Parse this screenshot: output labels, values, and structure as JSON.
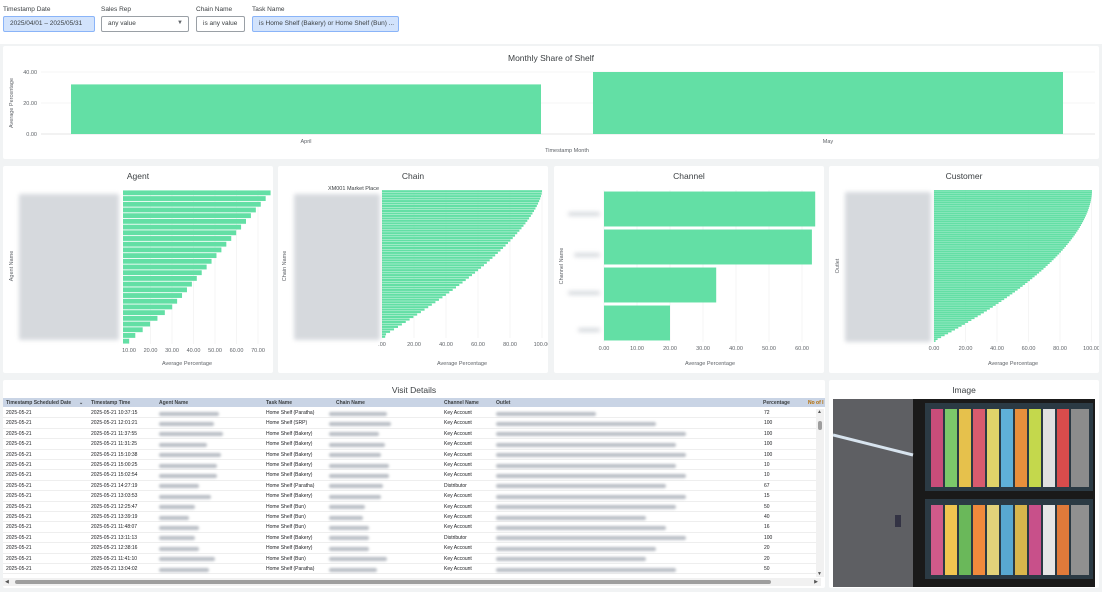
{
  "filters": [
    {
      "label": "Timestamp Date",
      "value": "2025/04/01 – 2025/05/31",
      "active": true
    },
    {
      "label": "Sales Rep",
      "value": "any value",
      "active": false
    },
    {
      "label": "Chain Name",
      "value": "is any value",
      "active": false
    },
    {
      "label": "Task Name",
      "value": "is Home Shelf (Bakery) or Home Shelf (Bun) ...",
      "active": true
    }
  ],
  "monthly": {
    "title": "Monthly Share of Shelf",
    "ylabel": "Average Percentage",
    "xlabel": "Timestamp Month",
    "yticks": [
      "40.00",
      "20.00",
      "0.00"
    ],
    "bars": [
      {
        "label": "April",
        "value": 32
      },
      {
        "label": "May",
        "value": 40
      }
    ]
  },
  "agent": {
    "title": "Agent",
    "ylabel": "Agent Name",
    "xlabel": "Average Percentage",
    "xticks": [
      "10.00",
      "20.00",
      "30.00",
      "40.00",
      "50.00",
      "60.00",
      "70.00"
    ]
  },
  "chain": {
    "title": "Chain",
    "ylabel": "Chain Name",
    "xlabel": "Average Percentage",
    "first_label": "XM001 Market Place",
    "xticks": [
      ".00",
      "20.00",
      "40.00",
      "60.00",
      "80.00",
      "100.00"
    ]
  },
  "channel": {
    "title": "Channel",
    "ylabel": "Channel Name",
    "xlabel": "Average Percentage",
    "xticks": [
      "0.00",
      "10.00",
      "20.00",
      "30.00",
      "40.00",
      "50.00",
      "60.00"
    ]
  },
  "customer": {
    "title": "Customer",
    "ylabel": "Outlet",
    "xlabel": "Average Percentage",
    "xticks": [
      "0.00",
      "20.00",
      "40.00",
      "60.00",
      "80.00",
      "100.00"
    ]
  },
  "visit": {
    "title": "Visit Details",
    "columns": [
      "Timestamp Scheduled Date",
      "Timestamp Time",
      "Agent Name",
      "Task Name",
      "Chain Name",
      "Channel Name",
      "Outlet",
      "Percentage",
      "No of I"
    ],
    "rows": [
      [
        "2025-05-21",
        "2025-05-21 10:37:15",
        "Home Shelf (Paratha)",
        "Key Account",
        "72"
      ],
      [
        "2025-05-21",
        "2025-05-21 12:01:21",
        "Home Shelf (SRP)",
        "Key Account",
        "100"
      ],
      [
        "2025-05-21",
        "2025-05-21 11:37:55",
        "Home Shelf (Bakery)",
        "Key Account",
        "100"
      ],
      [
        "2025-05-21",
        "2025-05-21 11:31:25",
        "Home Shelf (Bakery)",
        "Key Account",
        "100"
      ],
      [
        "2025-05-21",
        "2025-05-21 15:10:38",
        "Home Shelf (Bakery)",
        "Key Account",
        "100"
      ],
      [
        "2025-05-21",
        "2025-05-21 15:00:25",
        "Home Shelf (Bakery)",
        "Key Account",
        "10"
      ],
      [
        "2025-05-21",
        "2025-05-21 15:02:54",
        "Home Shelf (Bakery)",
        "Key Account",
        "10"
      ],
      [
        "2025-05-21",
        "2025-05-21 14:27:19",
        "Home Shelf (Paratha)",
        "Distributor",
        "67"
      ],
      [
        "2025-05-21",
        "2025-05-21 13:03:53",
        "Home Shelf (Bakery)",
        "Key Account",
        "15"
      ],
      [
        "2025-05-21",
        "2025-05-21 12:25:47",
        "Home Shelf (Bun)",
        "Key Account",
        "50"
      ],
      [
        "2025-05-21",
        "2025-05-21 13:39:19",
        "Home Shelf (Bun)",
        "Key Account",
        "40"
      ],
      [
        "2025-05-21",
        "2025-05-21 11:48:07",
        "Home Shelf (Bun)",
        "Key Account",
        "16"
      ],
      [
        "2025-05-21",
        "2025-05-21 13:11:13",
        "Home Shelf (Bakery)",
        "Distributor",
        "100"
      ],
      [
        "2025-05-21",
        "2025-05-21 12:38:16",
        "Home Shelf (Bakery)",
        "Key Account",
        "20"
      ],
      [
        "2025-05-21",
        "2025-05-21 11:41:10",
        "Home Shelf (Bun)",
        "Key Account",
        "20"
      ],
      [
        "2025-05-21",
        "2025-05-21 13:04:02",
        "Home Shelf (Paratha)",
        "Key Account",
        "50"
      ]
    ]
  },
  "image_panel": {
    "title": "Image"
  },
  "colors": {
    "bar": "#63dfa5",
    "header": "#c9d4e5"
  }
}
